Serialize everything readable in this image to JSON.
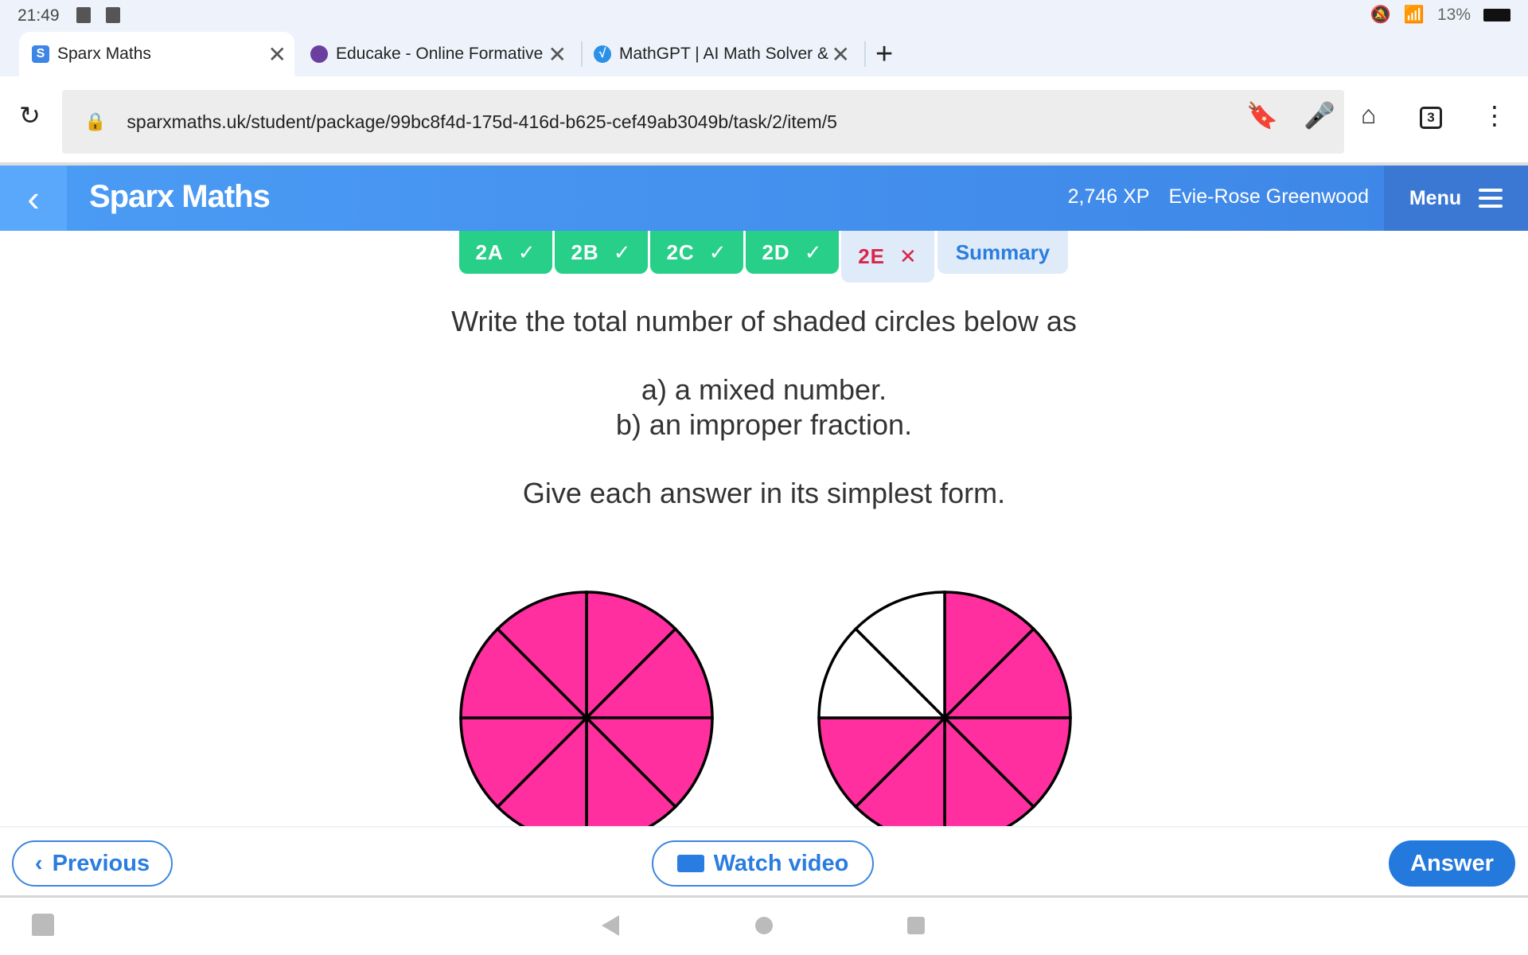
{
  "status": {
    "time": "21:49",
    "battery": "13%"
  },
  "browser": {
    "tabs": [
      {
        "title": "Sparx Maths",
        "favicon": "S",
        "color": "#3d85e6",
        "active": true
      },
      {
        "title": "Educake - Online Formative",
        "favicon": "",
        "color": "#6b3fa0",
        "active": false
      },
      {
        "title": "MathGPT | AI Math Solver &",
        "favicon": "√",
        "color": "#2a90e8",
        "active": false
      }
    ],
    "url": "sparxmaths.uk/student/package/99bc8f4d-175d-416d-b625-cef49ab3049b/task/2/item/5",
    "tab_count": "3"
  },
  "header": {
    "brand": "Sparx Maths",
    "xp": "2,746 XP",
    "user": "Evie-Rose Greenwood",
    "menu": "Menu"
  },
  "steps": [
    {
      "label": "2A",
      "status": "correct",
      "mark": "✓"
    },
    {
      "label": "2B",
      "status": "correct",
      "mark": "✓"
    },
    {
      "label": "2C",
      "status": "correct",
      "mark": "✓"
    },
    {
      "label": "2D",
      "status": "correct",
      "mark": "✓"
    },
    {
      "label": "2E",
      "status": "incorrect",
      "mark": "✕",
      "current": true
    },
    {
      "label": "Summary"
    }
  ],
  "question": {
    "line1": "Write the total number of shaded circles below as",
    "part_a": "a) a mixed number.",
    "part_b": "b) an improper fraction.",
    "line2": "Give each answer in its simplest form."
  },
  "figure": {
    "shade_color": "#ff2fa0",
    "circles": [
      {
        "sectors": 8,
        "shaded": [
          1,
          1,
          1,
          1,
          1,
          1,
          1,
          1
        ]
      },
      {
        "sectors": 8,
        "shaded": [
          1,
          1,
          1,
          1,
          1,
          1,
          0,
          0
        ]
      }
    ]
  },
  "footer": {
    "previous": "Previous",
    "watch_video": "Watch video",
    "answer": "Answer"
  }
}
